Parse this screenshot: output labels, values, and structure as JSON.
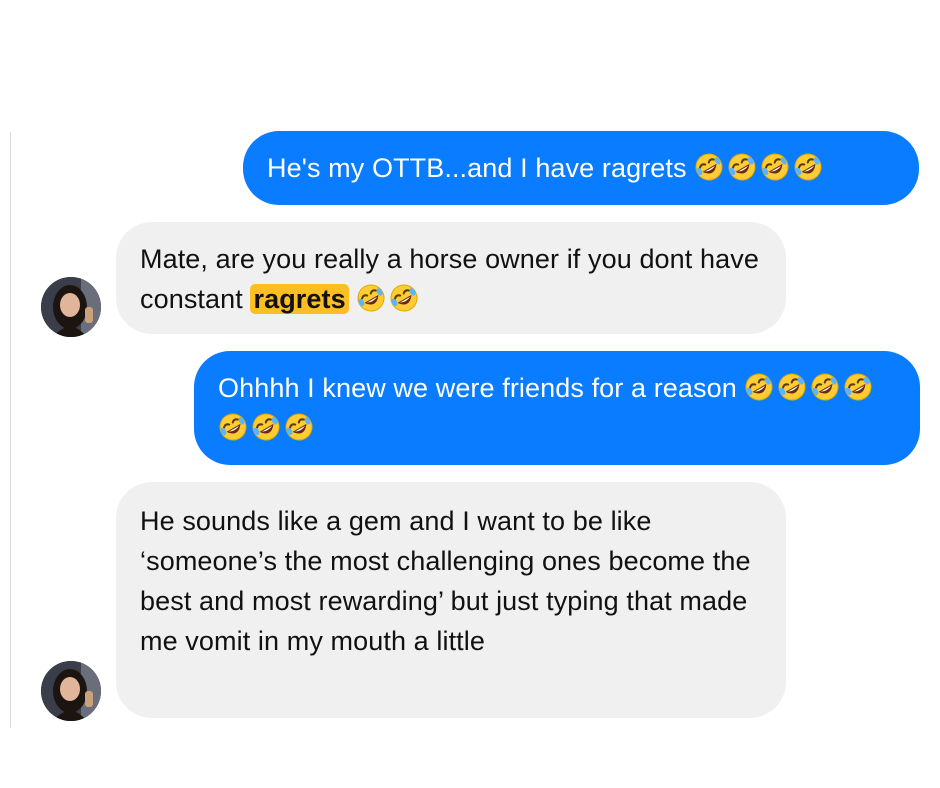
{
  "messages": [
    {
      "direction": "outgoing",
      "text": "He's my OTTB...and I have ragrets",
      "emoji_count": 4,
      "emoji": "rolling-on-floor-laughing"
    },
    {
      "direction": "incoming",
      "text_before": "Mate, are you really a horse owner if you dont have constant",
      "highlight": "ragrets",
      "emoji_count": 2,
      "emoji": "rolling-on-floor-laughing",
      "avatar": "contact-avatar"
    },
    {
      "direction": "outgoing",
      "text": "Ohhhh I knew we were friends for a reason",
      "emoji_count": 7,
      "emoji": "rolling-on-floor-laughing"
    },
    {
      "direction": "incoming",
      "text": "He sounds like a gem and I want to be like ‘someone’s the most challenging ones become the best and most rewarding’ but just typing that made me vomit in my mouth a little",
      "avatar": "contact-avatar"
    }
  ],
  "colors": {
    "outgoing_bubble": "#0a7cff",
    "incoming_bubble": "#f0f0f0",
    "highlight": "#fbbf24"
  }
}
